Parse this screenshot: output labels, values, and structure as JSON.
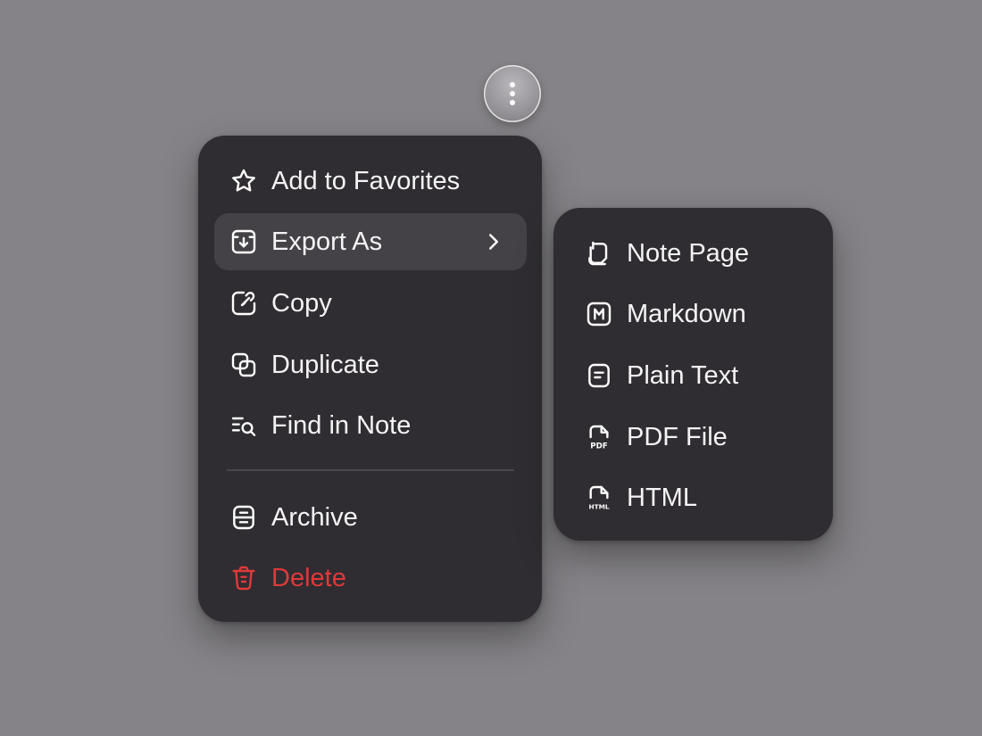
{
  "menu": {
    "items": [
      {
        "label": "Add to Favorites",
        "icon": "star-icon"
      },
      {
        "label": "Export As",
        "icon": "export-icon",
        "has_submenu": true,
        "active": true
      },
      {
        "label": "Copy",
        "icon": "copy-link-icon"
      },
      {
        "label": "Duplicate",
        "icon": "duplicate-icon"
      },
      {
        "label": "Find in Note",
        "icon": "find-in-note-icon"
      },
      {
        "label": "Archive",
        "icon": "archive-icon"
      },
      {
        "label": "Delete",
        "icon": "trash-icon",
        "danger": true
      }
    ]
  },
  "submenu": {
    "items": [
      {
        "label": "Note Page",
        "icon": "note-page-icon"
      },
      {
        "label": "Markdown",
        "icon": "markdown-icon"
      },
      {
        "label": "Plain Text",
        "icon": "plain-text-icon"
      },
      {
        "label": "PDF File",
        "icon": "pdf-file-icon"
      },
      {
        "label": "HTML",
        "icon": "html-file-icon"
      }
    ]
  },
  "colors": {
    "background": "#858387",
    "menu_bg": "#2f2d31",
    "active_item_bg": "#444246",
    "text": "#f4f3f5",
    "danger": "#e0393b"
  }
}
